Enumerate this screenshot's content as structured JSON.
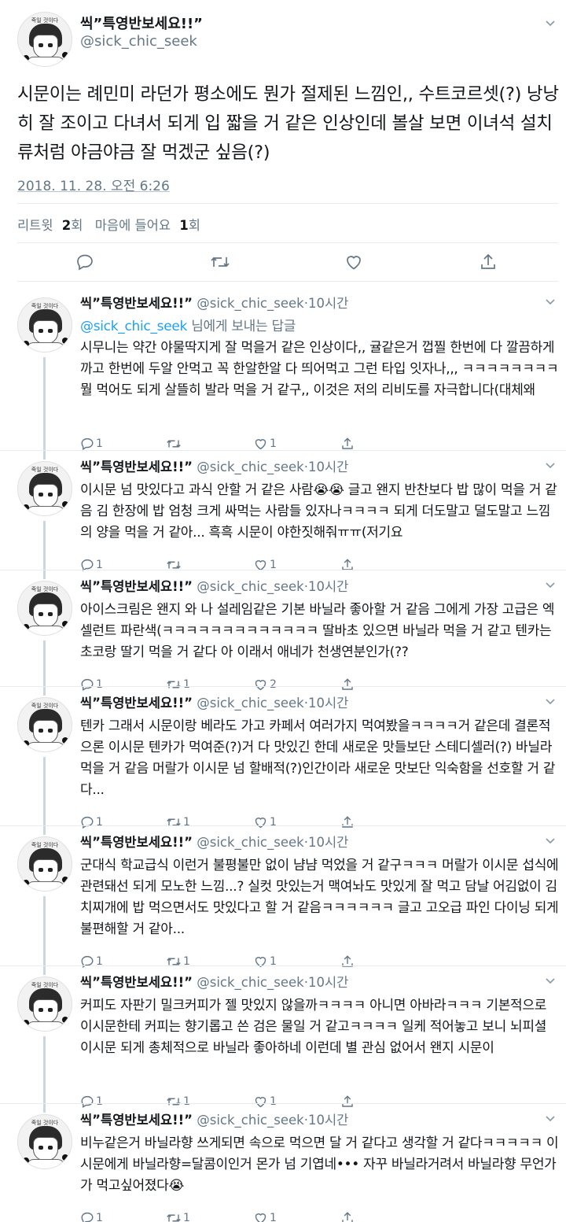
{
  "main_tweet": {
    "author_name": "씩”특영반보세요!!”",
    "author_handle": "@sick_chic_seek",
    "text": "시문이는 례민미 라던가 평소에도 뭔가 절제된 느낌인,, 수트코르셋(?) 낭낭히 잘 조이고 다녀서 되게 입 짧을 거 같은 인상인데 볼살 보면 이녀석 설치류처럼 야금야금 잘 먹겠군 싶음(?)",
    "timestamp": "2018. 11. 28. 오전 6:26",
    "stats": {
      "retweet_label": "리트윗",
      "retweet_count": "2",
      "retweet_unit": "회",
      "like_label": "마음에 들어요",
      "like_count": "1",
      "like_unit": "회"
    }
  },
  "avatar_text": "죽일 것이다",
  "replies": [
    {
      "name": "씩”특영반보세요!!”",
      "handle": "@sick_chic_seek",
      "time": "·10시간",
      "reply_to_handle": "@sick_chic_seek",
      "reply_to_suffix": " 님에게 보내는 답글",
      "text": "시무니는 약간 야물딱지게 잘 먹을거 같은 인상이다,, 귤같은거 껍찔 한번에 다 깔끔하게 까고 한번에 두알 안먹고 꼭 한알한알 다 띄어먹고 그런 타입 잇자나,,, ㅋㅋㅋㅋㅋㅋㅋㅋ 뭘 먹어도 되게 살뜰히 발라 먹을 거 같구,, 이것은 저의 리비도를 자극합니다(대체왜",
      "reply_count": "1",
      "retweet_count": "",
      "like_count": "1"
    },
    {
      "name": "씩”특영반보세요!!”",
      "handle": "@sick_chic_seek",
      "time": "·10시간",
      "text": "이시문 넘 맛있다고 과식 안할 거 같은 사람😭😭 글고 왠지 반찬보다 밥 많이 먹을 거 같음 김 한장에 밥 엄청 크게 싸먹는 사람들 있자나ㅋㅋㅋㅋ 되게 더도말고 덜도말고 느낌의 양을 먹을 거 같아... 흑흑 시문이 야한짓해줘ㅠㅠ(저기요",
      "reply_count": "1",
      "retweet_count": "",
      "like_count": "1"
    },
    {
      "name": "씩”특영반보세요!!”",
      "handle": "@sick_chic_seek",
      "time": "·10시간",
      "text": "아이스크림은 왠지 와 나 설레임같은 기본 바닐라 좋아할 거 같음 그에게 가장 고급은 엑셀런트 파란색(ㅋㅋㅋㅋㅋㅋㅋㅋㅋㅋㅋㅋㅋ 딸바초 있으면 바닐라 먹을 거 같고 텐카는 초코랑 딸기 먹을 거 같다 아 이래서 애네가 천생연분인가(??",
      "reply_count": "1",
      "retweet_count": "1",
      "like_count": "2"
    },
    {
      "name": "씩”특영반보세요!!”",
      "handle": "@sick_chic_seek",
      "time": "·10시간",
      "text": "텐카 그래서 시문이랑 베라도 가고 카페서 여러가지 먹여봤을ㅋㅋㅋㅋ거 같은데 결론적으론 이시문 텐카가 먹여준(?)거 다 맛있긴 한데 새로운 맛들보단 스테디셀러(?) 바닐라 먹을 거 같음 머랄가 이시문 넘 할배적(?)인간이라 새로운 맛보단 익숙함을 선호할 거 같다...",
      "reply_count": "1",
      "retweet_count": "1",
      "like_count": "1"
    },
    {
      "name": "씩”특영반보세요!!”",
      "handle": "@sick_chic_seek",
      "time": "·10시간",
      "text": "군대식 학교급식 이런거 불평불만 없이 냠냠 먹었을 거 같구ㅋㅋㅋ 머랄가 이시문 섭식에 관련돼선 되게 모노한 느낌...? 실컷 맛있는거 맥여놔도 맛있게 잘 먹고 담날 어김없이 김치찌개에 밥 먹으면서도 맛있다고 할 거 같음ㅋㅋㅋㅋㅋㅋ 글고 고오급 파인 다이닝 되게 불편해할 거 같아...",
      "reply_count": "1",
      "retweet_count": "1",
      "like_count": "1"
    },
    {
      "name": "씩”특영반보세요!!”",
      "handle": "@sick_chic_seek",
      "time": "·10시간",
      "text": "커피도 자판기 밀크커피가 젤 맛있지 않을까ㅋㅋㅋㅋ 아니면 아바라ㅋㅋㅋ 기본적으로 이시문한테 커피는 향기롭고 쓴 검은 물일 거 같고ㅋㅋㅋㅋ 일케 적어놓고 보니 뇌피셜 이시문 되게 총체적으로 바닐라 좋아하네 이런데 별 관심 없어서 왠지 시문이",
      "reply_count": "1",
      "retweet_count": "1",
      "like_count": "1"
    },
    {
      "name": "씩”특영반보세요!!”",
      "handle": "@sick_chic_seek",
      "time": "·10시간",
      "text": "비누같은거 바닐라향 쓰게되면 속으로 먹으면 달 거 같다고 생각할 거 같다ㅋㅋㅋㅋㅋ 이시문에게 바닐라향=달콤이인거 몬가 넘 기엽네••• 자꾸 바닐라거려서 바닐라향 무언가가 먹고싶어졌다😭",
      "reply_count": "1",
      "retweet_count": "1",
      "like_count": "1"
    }
  ],
  "icons": {
    "reply": "reply-icon",
    "retweet": "retweet-icon",
    "like": "heart-icon",
    "share": "share-icon",
    "menu": "chevron-down-icon"
  },
  "colors": {
    "text": "#14171a",
    "secondary": "#657786",
    "link": "#1da1f2",
    "divider": "#e6ecf0",
    "thread_line": "#ccd6dd"
  }
}
